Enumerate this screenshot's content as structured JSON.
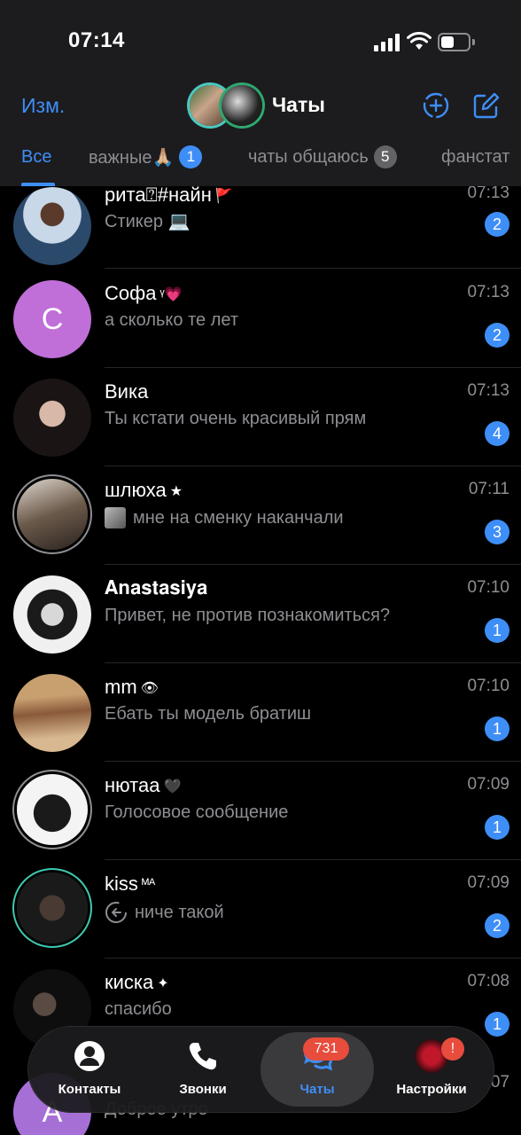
{
  "status": {
    "time": "07:14"
  },
  "header": {
    "edit_label": "Изм.",
    "title": "Чаты",
    "tabs": [
      {
        "label": "Все",
        "count": null
      },
      {
        "label": "важные🙏🏼",
        "count": "1"
      },
      {
        "label": "чаты общаюсь",
        "count": "5"
      },
      {
        "label": "фанстат",
        "count": null
      }
    ]
  },
  "chats": [
    {
      "name": "рита⍰#найн",
      "name_emoji": "🚩",
      "message": "Стикер 💻",
      "time": "07:13",
      "unread": "2",
      "avatar_color": "#2b4a6b"
    },
    {
      "name": "Софа",
      "name_emoji": "ᵞ💗",
      "message": "а сколько те лет",
      "time": "07:13",
      "unread": "2",
      "avatar_letter": "С",
      "avatar_color": "#c06fd8"
    },
    {
      "name": "Вика",
      "name_emoji": "",
      "message": "Ты кстати очень красивый прям",
      "time": "07:13",
      "unread": "4",
      "avatar_color": "#3a2e2a"
    },
    {
      "name": "шлюха",
      "name_emoji": "★",
      "message": "мне на сменку наканчали",
      "time": "07:11",
      "unread": "3",
      "avatar_color": "#5c4a3a"
    },
    {
      "name": "𝐀𝐧𝐚𝐬𝐭𝐚𝐬𝐢𝐲𝐚",
      "name_emoji": "",
      "message": "Привет, не против познакомиться?",
      "time": "07:10",
      "unread": "1",
      "avatar_color": "#6b6b6b"
    },
    {
      "name": "mm",
      "name_emoji": "👁",
      "message": "Ебать ты модель братиш",
      "time": "07:10",
      "unread": "1",
      "avatar_color": "#a07a4a"
    },
    {
      "name": "нютаа",
      "name_emoji": "🖤",
      "message": "Голосовое сообщение",
      "time": "07:09",
      "unread": "1",
      "avatar_color": "#e8e8e8"
    },
    {
      "name": "kiss",
      "name_emoji": "ᴹᴬ",
      "message": "ниче такой",
      "time": "07:09",
      "unread": "2",
      "avatar_color": "#1e1e1e"
    },
    {
      "name": "киска",
      "name_emoji": "✦",
      "message": "спасибо",
      "time": "07:08",
      "unread": "1",
      "avatar_color": "#161616"
    }
  ],
  "peek": {
    "letter": "А",
    "message": "Доброе утро",
    "time": "07"
  },
  "tabbar": {
    "contacts": "Контакты",
    "calls": "Звонки",
    "chats": "Чаты",
    "chats_badge": "731",
    "settings": "Настройки",
    "settings_badge": "!"
  }
}
